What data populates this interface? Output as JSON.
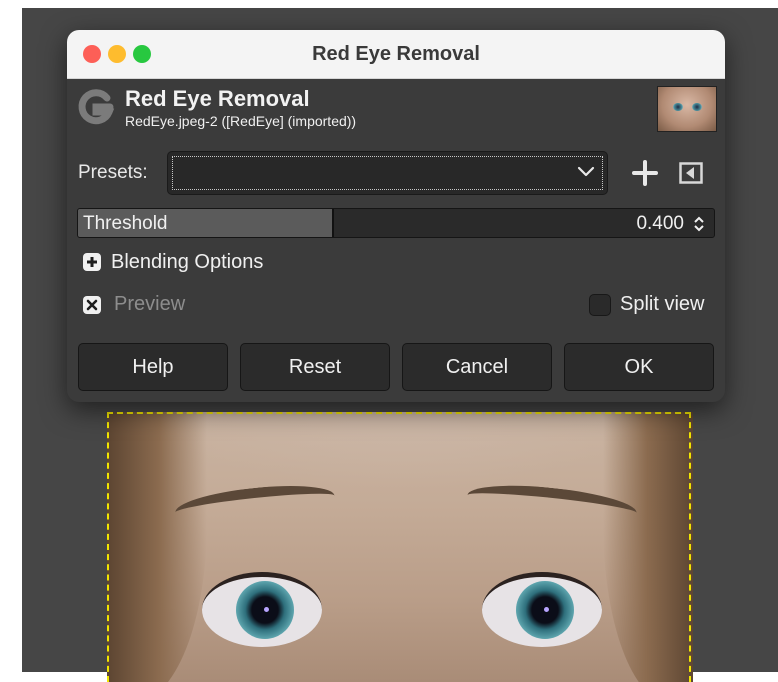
{
  "window": {
    "title": "Red Eye Removal"
  },
  "header": {
    "title": "Red Eye Removal",
    "subtitle": "RedEye.jpeg-2 ([RedEye] (imported))",
    "icon": "gimp-logo-icon"
  },
  "presets": {
    "label": "Presets:",
    "value": "",
    "add_icon": "plus-icon",
    "save_icon": "menu-arrow-icon"
  },
  "threshold": {
    "label": "Threshold",
    "value": "0.400",
    "fraction": 0.4
  },
  "blending": {
    "label": "Blending Options",
    "expanded": false
  },
  "preview": {
    "label": "Preview",
    "checked": true
  },
  "split_view": {
    "label": "Split view",
    "checked": false
  },
  "buttons": {
    "help": "Help",
    "reset": "Reset",
    "cancel": "Cancel",
    "ok": "OK"
  },
  "colors": {
    "accent_marquee": "#f2e600",
    "dialog_bg": "#3b3b3b",
    "canvas_bg": "#464646"
  }
}
